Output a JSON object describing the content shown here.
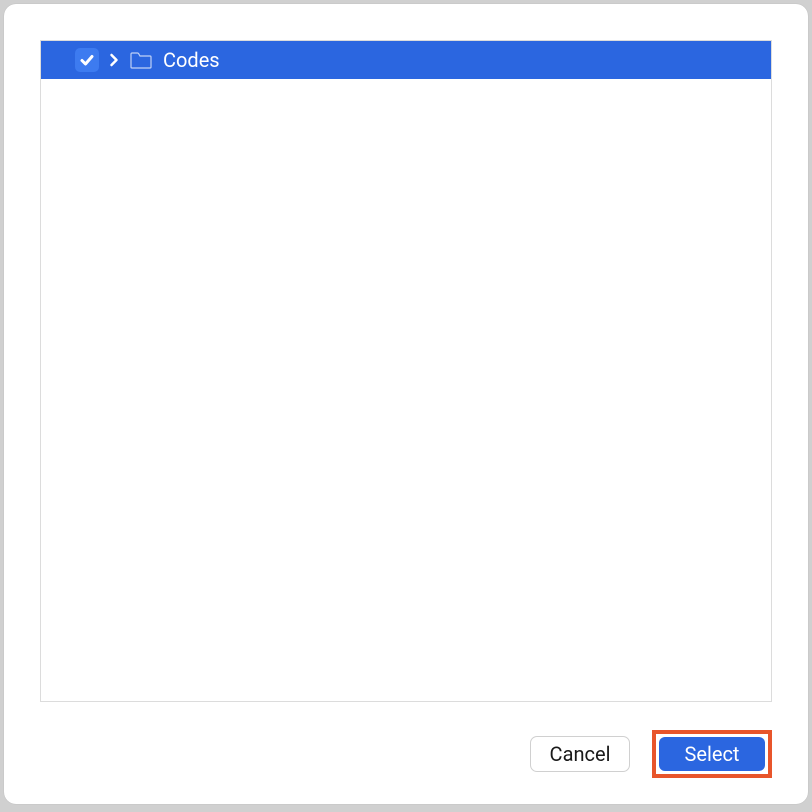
{
  "tree": {
    "items": [
      {
        "label": "Codes",
        "checked": true,
        "selected": true,
        "expandable": true
      }
    ]
  },
  "buttons": {
    "cancel_label": "Cancel",
    "select_label": "Select"
  },
  "colors": {
    "selection_bg": "#2b66e0",
    "highlight_border": "#e8552b"
  }
}
